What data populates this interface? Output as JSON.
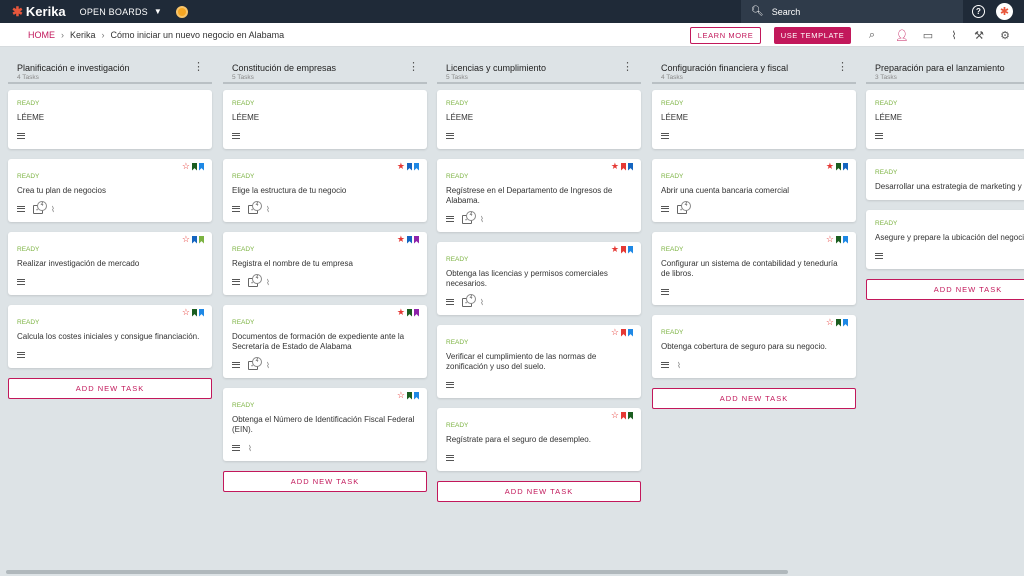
{
  "app": {
    "logo_text": "Kerika",
    "open_boards_label": "OPEN BOARDS"
  },
  "search": {
    "placeholder": "Search"
  },
  "breadcrumb": {
    "home": "HOME",
    "workspace": "Kerika",
    "board": "Cómo iniciar un nuevo negocio en Alabama"
  },
  "toolbar": {
    "learn_more": "LEARN MORE",
    "use_template": "USE TEMPLATE"
  },
  "add_task_label": "ADD NEW TASK",
  "columns": [
    {
      "title": "Planificación e investigación",
      "count": "4 Tasks",
      "cards": [
        {
          "status": "READY",
          "title": "LÉEME"
        },
        {
          "status": "READY",
          "title": "Crea tu plan de negocios"
        },
        {
          "status": "READY",
          "title": "Realizar investigación de mercado"
        },
        {
          "status": "READY",
          "title": "Calcula los costes iniciales y consigue financiación."
        }
      ]
    },
    {
      "title": "Constitución de empresas",
      "count": "5 Tasks",
      "cards": [
        {
          "status": "READY",
          "title": "LÉEME"
        },
        {
          "status": "READY",
          "title": "Elige la estructura de tu negocio"
        },
        {
          "status": "READY",
          "title": "Registra el nombre de tu empresa"
        },
        {
          "status": "READY",
          "title": "Documentos de formación de expediente ante la Secretaría de Estado de Alabama"
        },
        {
          "status": "READY",
          "title": "Obtenga el Número de Identificación Fiscal Federal (EIN)."
        }
      ]
    },
    {
      "title": "Licencias y cumplimiento",
      "count": "5 Tasks",
      "cards": [
        {
          "status": "READY",
          "title": "LÉEME"
        },
        {
          "status": "READY",
          "title": "Regístrese en el Departamento de Ingresos de Alabama."
        },
        {
          "status": "READY",
          "title": "Obtenga las licencias y permisos comerciales necesarios."
        },
        {
          "status": "READY",
          "title": "Verificar el cumplimiento de las normas de zonificación y uso del suelo."
        },
        {
          "status": "READY",
          "title": "Regístrate para el seguro de desempleo."
        }
      ]
    },
    {
      "title": "Configuración financiera y fiscal",
      "count": "4 Tasks",
      "cards": [
        {
          "status": "READY",
          "title": "LÉEME"
        },
        {
          "status": "READY",
          "title": "Abrir una cuenta bancaria comercial"
        },
        {
          "status": "READY",
          "title": "Configurar un sistema de contabilidad y teneduría de libros."
        },
        {
          "status": "READY",
          "title": "Obtenga cobertura de seguro para su negocio."
        }
      ]
    },
    {
      "title": "Preparación para el lanzamiento",
      "count": "3 Tasks",
      "cards": [
        {
          "status": "READY",
          "title": "LÉEME"
        },
        {
          "status": "READY",
          "title": "Desarrollar una estrategia de marketing y marca."
        },
        {
          "status": "READY",
          "title": "Asegure y prepare la ubicación del negocio"
        }
      ]
    }
  ],
  "colors": {
    "accent": "#c2185b",
    "ready": "#7cb342",
    "topbar": "#1f2a38",
    "board_bg": "#dde3e6"
  }
}
